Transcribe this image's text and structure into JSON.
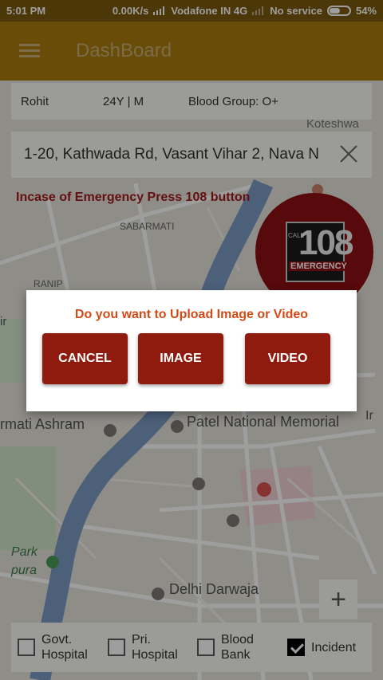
{
  "status_bar": {
    "time": "5:01 PM",
    "net_speed": "0.00K/s",
    "carrier": "Vodafone IN 4G",
    "second_sim": "No service",
    "battery": "54%"
  },
  "app_bar": {
    "menu_icon": "hamburger-icon",
    "title": "DashBoard"
  },
  "patient": {
    "name": "Rohit",
    "age_gender": "24Y | M",
    "blood_group": "Blood Group: O+"
  },
  "search": {
    "address": "1-20, Kathwada Rd, Vasant Vihar 2, Nava N",
    "close_icon": "close-icon"
  },
  "emergency_text": "Incase of Emergency Press 108 button",
  "emergency_badge": {
    "number": "108",
    "call_label": "CALL",
    "emergency_label": "EMERGENCY"
  },
  "map_labels": {
    "sabarmati": "SABARMATI",
    "ranip": "RANIP",
    "kotesh": "Koteshwa",
    "ashram": "rmati Ashram",
    "patel": "Patel National Memorial",
    "park": "Park",
    "pura": "pura",
    "delhi": "Delhi Darwaja",
    "left_edge": "ir",
    "right_edge": "Ir"
  },
  "zoom": {
    "plus_label": "+"
  },
  "filters": [
    {
      "label_line1": "Govt.",
      "label_line2": "Hospital",
      "checked": false
    },
    {
      "label_line1": "Pri.",
      "label_line2": "Hospital",
      "checked": false
    },
    {
      "label_line1": "Blood",
      "label_line2": "Bank",
      "checked": false
    },
    {
      "label_line1": "Incident",
      "label_line2": "",
      "checked": true
    }
  ],
  "dialog": {
    "message": "Do you want to Upload Image or Video",
    "cancel_label": "CANCEL",
    "image_label": "IMAGE",
    "video_label": "VIDEO"
  },
  "colors": {
    "app_bar": "#a97b0d",
    "dialog_button": "#8e1b0e",
    "dialog_text": "#d24b16",
    "emergency_text": "#a21a1a",
    "river": "#7b9cc6"
  }
}
